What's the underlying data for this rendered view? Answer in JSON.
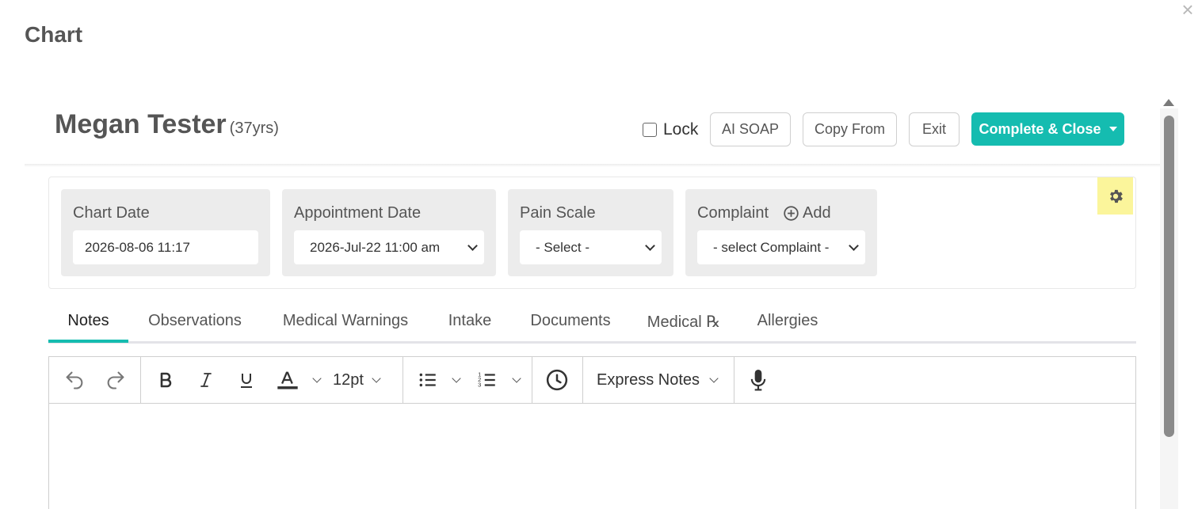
{
  "window": {
    "title": "Chart",
    "close_glyph": "×"
  },
  "patient": {
    "name": "Megan Tester",
    "age": "(37yrs)"
  },
  "header": {
    "lock_label": "Lock",
    "ai_soap_label": "AI SOAP",
    "copy_from_label": "Copy From",
    "exit_label": "Exit",
    "complete_label": "Complete & Close"
  },
  "fields": {
    "chart_date": {
      "label": "Chart Date",
      "value": "2026-08-06 11:17"
    },
    "appointment_date": {
      "label": "Appointment Date",
      "value": "2026-Jul-22 11:00 am"
    },
    "pain_scale": {
      "label": "Pain Scale",
      "value": "- Select -"
    },
    "complaint": {
      "label": "Complaint",
      "add_label": "Add",
      "value": "- select Complaint -"
    }
  },
  "tabs": [
    {
      "label": "Notes",
      "active": true
    },
    {
      "label": "Observations"
    },
    {
      "label": "Medical Warnings"
    },
    {
      "label": "Intake"
    },
    {
      "label": "Documents"
    },
    {
      "label": "Medical ℞"
    },
    {
      "label": "Allergies"
    }
  ],
  "toolbar": {
    "font_size": "12pt",
    "express_notes_label": "Express Notes",
    "icons": [
      "undo-icon",
      "redo-icon",
      "bold-icon",
      "italic-icon",
      "underline-icon",
      "font-color-icon",
      "bullet-list-icon",
      "numbered-list-icon",
      "clock-icon",
      "microphone-icon"
    ]
  },
  "colors": {
    "accent": "#15bcb0",
    "gear_highlight": "#fbf59b",
    "field_bg": "#ececec"
  }
}
